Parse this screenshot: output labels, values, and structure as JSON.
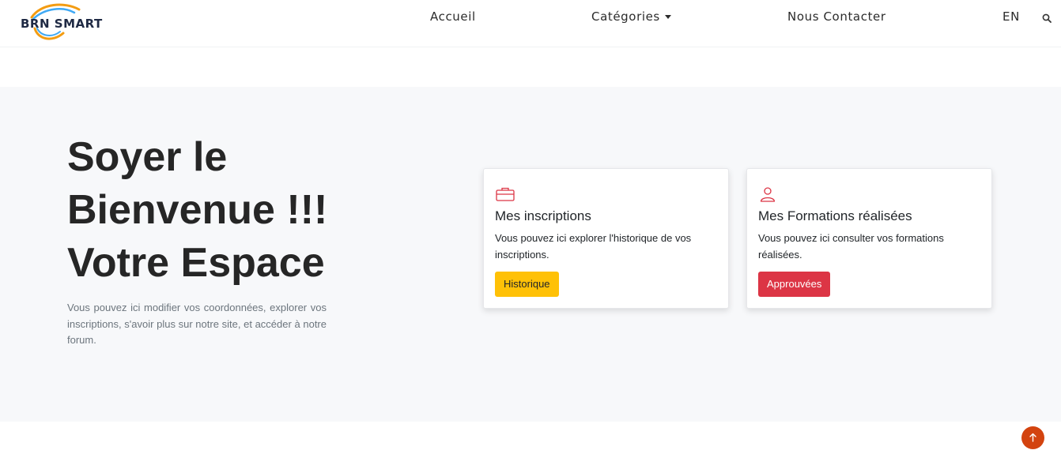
{
  "header": {
    "logo_text": "BRN SMART",
    "nav": {
      "home": "Accueil",
      "categories": "Catégories",
      "contact": "Nous Contacter",
      "language": "EN"
    },
    "icons": [
      "search-icon",
      "chevron-down-icon"
    ]
  },
  "hero": {
    "title_lines": [
      "Soyer le",
      "Bienvenue !!!",
      "Votre Espace"
    ],
    "description": "Vous pouvez ici modifier vos coordonnées, explorer vos inscriptions, s'avoir plus sur notre site, et accéder à notre forum."
  },
  "cards": [
    {
      "icon": "briefcase-icon",
      "title": "Mes inscriptions",
      "text": "Vous pouvez ici explorer l'historique de vos inscriptions.",
      "button": "Historique",
      "button_color": "#ffc107"
    },
    {
      "icon": "user-icon",
      "title": "Mes Formations réalisées",
      "text": "Vous pouvez ici consulter vos formations réalisées.",
      "button": "Approuvées",
      "button_color": "#dc3545"
    }
  ],
  "colors": {
    "accent_red": "#dc3545",
    "accent_yellow": "#ffc107",
    "hero_bg": "#f7f8fa",
    "scroll_top": "#d3430f"
  },
  "scroll_top_icon": "arrow-up-icon"
}
